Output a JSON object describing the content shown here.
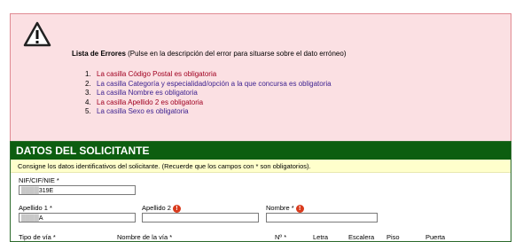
{
  "errors": {
    "title_bold": "Lista de Errores",
    "title_rest": " (Pulse en la descripción del error para situarse sobre el dato erróneo)",
    "items": [
      {
        "num": "1.",
        "text": "La casilla Código Postal es obligatoria"
      },
      {
        "num": "2.",
        "text": "La casilla Categoría y especialidad/opción a la que concursa es obligatoria"
      },
      {
        "num": "3.",
        "text": "La casilla Nombre es obligatoria"
      },
      {
        "num": "4.",
        "text": "La casilla Apellido 2 es obligatoria"
      },
      {
        "num": "5.",
        "text": "La casilla Sexo es obligatoria"
      }
    ]
  },
  "panel": {
    "title": "DATOS DEL SOLICITANTE",
    "note": "Consigne los datos identificativos del solicitante. (Recuerde que los campos con * son obligatorios).",
    "nif_label": "NIF/CIF/NIE *",
    "nif_value": "319E",
    "apellido1_label": "Apellido 1 *",
    "apellido1_value": "A",
    "apellido2_label": "Apellido 2",
    "nombre_label": "Nombre *",
    "row3": {
      "tipo_via": "Tipo de vía *",
      "nombre_via": "Nombre de la vía *",
      "numero": "Nº *",
      "letra": "Letra",
      "escalera": "Escalera",
      "piso": "Piso",
      "puerta": "Puerta"
    }
  },
  "colors": {
    "error_bg": "#fbe0e3",
    "header_green": "#0d5e10",
    "note_yellow": "#ffffcc",
    "link_red": "#a00020",
    "link_purple": "#3a1f8f"
  }
}
